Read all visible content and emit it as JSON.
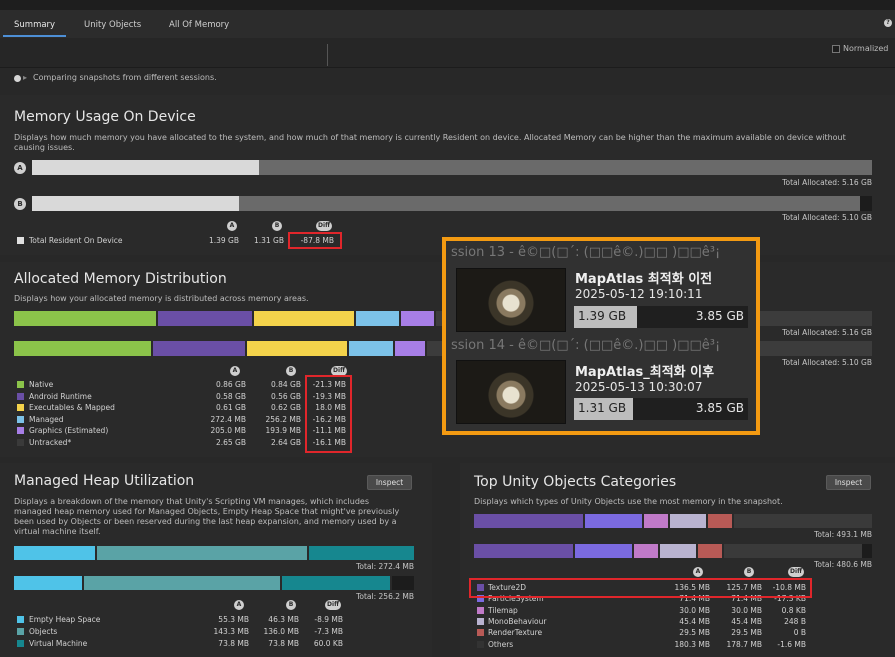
{
  "tabs": [
    {
      "label": "Summary"
    },
    {
      "label": "Unity Objects"
    },
    {
      "label": "All Of Memory"
    }
  ],
  "toolbar": {
    "normalized_label": "Normalized"
  },
  "info": {
    "text": "Comparing snapshots from different sessions."
  },
  "memory_usage": {
    "title": "Memory Usage On Device",
    "description_line1": "Displays how much memory you have allocated to the system, and how much of that memory is currently Resident on device. Allocated Memory can be higher than the maximum available on device without",
    "description_line2": "causing issues.",
    "a_label": "A",
    "b_label": "B",
    "a_resident_fraction": 0.27,
    "b_resident_fraction": 0.25,
    "a_total": "Total Allocated: 5.16 GB",
    "b_total": "Total Allocated: 5.10 GB",
    "col_a": "A",
    "col_b": "B",
    "col_diff": "Diff",
    "row": {
      "label": "Total Resident On Device",
      "a": "1.39 GB",
      "b": "1.31 GB",
      "diff": "-87.8 MB"
    }
  },
  "allocated": {
    "title": "Allocated Memory Distribution",
    "description": "Displays how your allocated memory is distributed across memory areas.",
    "a_total": "Total Allocated: 5.16 GB",
    "b_total": "Total Allocated: 5.10 GB",
    "col_a": "A",
    "col_b": "B",
    "col_diff": "Diff",
    "rows": [
      {
        "label": "Native",
        "a": "0.86 GB",
        "b": "0.84 GB",
        "diff": "-21.3 MB",
        "color": "#8bc34a"
      },
      {
        "label": "Android Runtime",
        "a": "0.58 GB",
        "b": "0.56 GB",
        "diff": "-19.3 MB",
        "color": "#6a4fa6"
      },
      {
        "label": "Executables & Mapped",
        "a": "0.61 GB",
        "b": "0.62 GB",
        "diff": "18.0 MB",
        "color": "#f4d34b"
      },
      {
        "label": "Managed",
        "a": "272.4 MB",
        "b": "256.2 MB",
        "diff": "-16.2 MB",
        "color": "#7cc2e8"
      },
      {
        "label": "Graphics (Estimated)",
        "a": "205.0 MB",
        "b": "193.9 MB",
        "diff": "-11.1 MB",
        "color": "#a77ee6"
      },
      {
        "label": "Untracked*",
        "a": "2.65 GB",
        "b": "2.64 GB",
        "diff": "-16.1 MB",
        "color": "#3a3a3a"
      }
    ]
  },
  "overlay": {
    "card1": {
      "session": "ssion 13 - ê©□(□´: (□□ê©.)□□ )□□ê³¡",
      "title": "MapAtlas 최적화 이전",
      "date": "2025-05-12 19:10:11",
      "used": "1.39 GB",
      "total": "3.85 GB",
      "fraction": 0.36
    },
    "card2": {
      "session": "ssion 14 - ê©□(□´: (□□ê©.)□□ )□□ê³¡",
      "title": "MapAtlas_최적화 이후",
      "date": "2025-05-13 10:30:07",
      "used": "1.31 GB",
      "total": "3.85 GB",
      "fraction": 0.34
    }
  },
  "managed_heap": {
    "title": "Managed Heap Utilization",
    "inspect": "Inspect",
    "description": [
      "Displays a breakdown of the memory that Unity's Scripting VM manages, which includes",
      "managed heap memory used for Managed Objects, Empty Heap Space that might've previously",
      "been used by Objects or been reserved during the last heap expansion, and memory used by a",
      "virtual machine itself."
    ],
    "a_total": "Total: 272.4 MB",
    "b_total": "Total: 256.2 MB",
    "col_a": "A",
    "col_b": "B",
    "col_diff": "Diff",
    "rows": [
      {
        "label": "Empty Heap Space",
        "a": "55.3 MB",
        "b": "46.3 MB",
        "diff": "-8.9 MB",
        "color": "#4fc3e8"
      },
      {
        "label": "Objects",
        "a": "143.3 MB",
        "b": "136.0 MB",
        "diff": "-7.3 MB",
        "color": "#5aa3a6"
      },
      {
        "label": "Virtual Machine",
        "a": "73.8 MB",
        "b": "73.8 MB",
        "diff": "60.0 KB",
        "color": "#16878f"
      }
    ]
  },
  "top_objects": {
    "title": "Top Unity Objects Categories",
    "inspect": "Inspect",
    "description": "Displays which types of Unity Objects use the most memory in the snapshot.",
    "a_total": "Total: 493.1 MB",
    "b_total": "Total: 480.6 MB",
    "col_a": "A",
    "col_b": "B",
    "col_diff": "Diff",
    "rows": [
      {
        "label": "Texture2D",
        "a": "136.5 MB",
        "b": "125.7 MB",
        "diff": "-10.8 MB",
        "color": "#6a4fa6"
      },
      {
        "label": "ParticleSystem",
        "a": "71.4 MB",
        "b": "71.4 MB",
        "diff": "-17.3 KB",
        "color": "#7b6ae0"
      },
      {
        "label": "Tilemap",
        "a": "30.0 MB",
        "b": "30.0 MB",
        "diff": "0.8 KB",
        "color": "#c07ac8"
      },
      {
        "label": "MonoBehaviour",
        "a": "45.4 MB",
        "b": "45.4 MB",
        "diff": "248 B",
        "color": "#b9b3d0"
      },
      {
        "label": "RenderTexture",
        "a": "29.5 MB",
        "b": "29.5 MB",
        "diff": "0 B",
        "color": "#b85a56"
      },
      {
        "label": "Others",
        "a": "180.3 MB",
        "b": "178.7 MB",
        "diff": "-1.6 MB",
        "color": "#333333"
      }
    ]
  }
}
